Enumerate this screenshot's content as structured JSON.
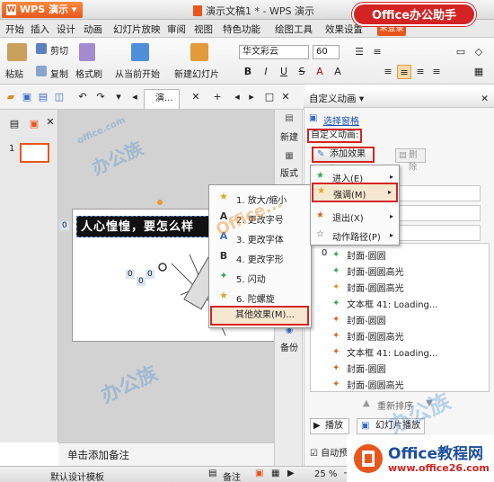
{
  "titlebar": {
    "app_name": "WPS 演示",
    "doc_title": "演示文稿1 * - WPS 演示",
    "brand_badge": "Office办公助手"
  },
  "menubar": {
    "items": [
      "开始",
      "插入",
      "设计",
      "动画",
      "幻灯片放映",
      "审阅",
      "视图",
      "特色功能",
      "绘图工具",
      "效果设置"
    ],
    "user_label": "未登录"
  },
  "ribbon": {
    "paste": "粘贴",
    "cut": "剪切",
    "copy": "复制",
    "format_painter": "格式刷",
    "from_current": "从当前开始",
    "new_slide": "新建幻灯片",
    "font_name": "华文彩云",
    "font_size": "60",
    "bold": "B",
    "italic": "I",
    "underline": "U",
    "strike": "S"
  },
  "toolbar2": {
    "slide_tab": "演..."
  },
  "slide": {
    "thumb_number": "1",
    "banner_text": "人心惶惶，要怎么样",
    "placeholder_marker": "0",
    "small_labels": [
      "0",
      "0",
      "0"
    ],
    "notes_placeholder": "单击添加备注"
  },
  "side_col": {
    "new_label": "新建",
    "layout_label": "版式",
    "backup_label": "备份"
  },
  "effect_menu": {
    "items": [
      {
        "glyph": "★",
        "label": "1. 放大/缩小"
      },
      {
        "glyph": "A",
        "label": "2. 更改字号"
      },
      {
        "glyph": "A",
        "label": "3. 更改字体"
      },
      {
        "glyph": "B",
        "label": "4. 更改字形"
      },
      {
        "glyph": "✦",
        "label": "5. 闪动"
      },
      {
        "glyph": "★",
        "label": "6. 陀螺旋"
      }
    ],
    "more": "其他效果(M)..."
  },
  "task_pane": {
    "header": "自定义动画 ▾",
    "select_pane": "选择窗格",
    "custom_anim": "自定义动画:",
    "add_effect": "添加效果 ▾",
    "delete": "删除",
    "list_number": "0",
    "anim_items": [
      "封面-圆圆",
      "封面-圆圆高光",
      "封面-圆圆高光",
      "文本框 41: Loading...",
      "封面-圆圆",
      "封面-圆圆高光",
      "文本框 41: Loading...",
      "封面-圆圆",
      "封面-圆圆高光"
    ],
    "reorder": "重新排序",
    "play": "播放",
    "slideshow": "幻灯片播放",
    "autopreview": "自动预览"
  },
  "add_menu": {
    "items": [
      "进入(E)",
      "强调(M)",
      "退出(X)",
      "动作路径(P)"
    ]
  },
  "statusbar": {
    "template": "默认设计模板",
    "notes": "备注",
    "zoom": "25 %"
  },
  "watermarks": {
    "site_a": "office.com",
    "site_b": "办公族",
    "center": "Office..."
  },
  "footer_badge": {
    "title": "Office教程网",
    "url": "www.office26.com"
  }
}
